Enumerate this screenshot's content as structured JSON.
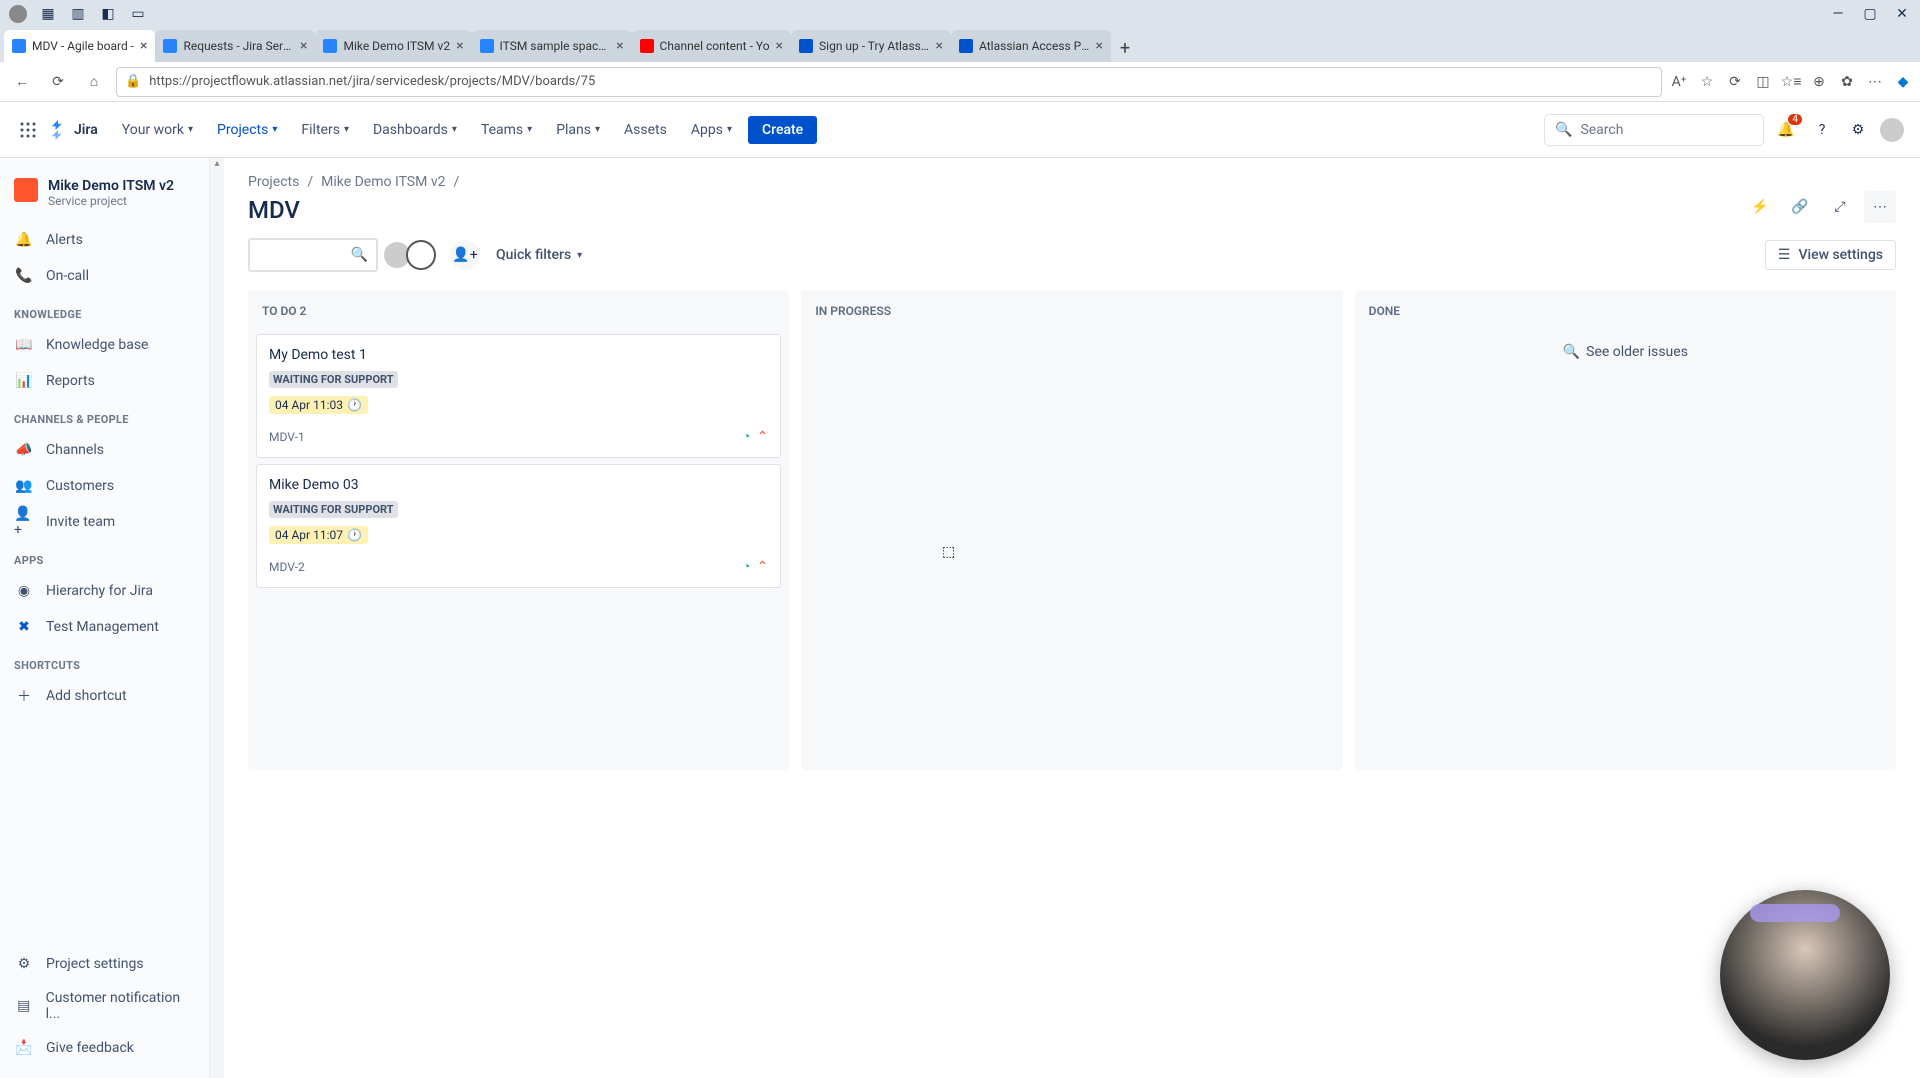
{
  "browser": {
    "url": "https://projectflowuk.atlassian.net/jira/servicedesk/projects/MDV/boards/75",
    "tabs": [
      {
        "title": "MDV - Agile board -",
        "active": true,
        "fav": "jira"
      },
      {
        "title": "Requests - Jira Servic",
        "fav": "jira"
      },
      {
        "title": "Mike Demo ITSM v2",
        "fav": "jira"
      },
      {
        "title": "ITSM sample space -",
        "fav": "jira"
      },
      {
        "title": "Channel content - Yo",
        "fav": "yt"
      },
      {
        "title": "Sign up - Try Atlassian",
        "fav": "atl"
      },
      {
        "title": "Atlassian Access Prici",
        "fav": "atl"
      }
    ]
  },
  "topnav": {
    "product": "Jira",
    "items": [
      "Your work",
      "Projects",
      "Filters",
      "Dashboards",
      "Teams",
      "Plans",
      "Assets",
      "Apps"
    ],
    "active_index": 1,
    "create": "Create",
    "search_placeholder": "Search",
    "notif_count": "4"
  },
  "sidebar": {
    "project_name": "Mike Demo ITSM v2",
    "project_type": "Service project",
    "items_top": [
      {
        "icon": "bell",
        "label": "Alerts"
      },
      {
        "icon": "phone",
        "label": "On-call"
      }
    ],
    "group_knowledge": "KNOWLEDGE",
    "items_knowledge": [
      {
        "icon": "book",
        "label": "Knowledge base"
      },
      {
        "icon": "chart",
        "label": "Reports"
      }
    ],
    "group_channels": "CHANNELS & PEOPLE",
    "items_channels": [
      {
        "icon": "megaphone",
        "label": "Channels"
      },
      {
        "icon": "people",
        "label": "Customers"
      },
      {
        "icon": "invite",
        "label": "Invite team"
      }
    ],
    "group_apps": "APPS",
    "items_apps": [
      {
        "icon": "hierarchy",
        "label": "Hierarchy for Jira"
      },
      {
        "icon": "test",
        "label": "Test Management"
      }
    ],
    "group_shortcuts": "SHORTCUTS",
    "items_shortcuts": [
      {
        "icon": "plus",
        "label": "Add shortcut"
      }
    ],
    "items_bottom": [
      {
        "icon": "gear",
        "label": "Project settings"
      },
      {
        "icon": "list",
        "label": "Customer notification l..."
      },
      {
        "icon": "feedback",
        "label": "Give feedback"
      }
    ]
  },
  "breadcrumb": [
    "Projects",
    "Mike Demo ITSM v2"
  ],
  "page_title": "MDV",
  "toolbar": {
    "quick_filters": "Quick filters",
    "view_settings": "View settings"
  },
  "board": {
    "columns": [
      {
        "title": "TO DO 2"
      },
      {
        "title": "IN PROGRESS"
      },
      {
        "title": "DONE",
        "older": "See older issues"
      }
    ],
    "cards": [
      {
        "title": "My Demo test 1",
        "status": "WAITING FOR SUPPORT",
        "due": "04 Apr 11:03",
        "key": "MDV-1"
      },
      {
        "title": "Mike Demo 03",
        "status": "WAITING FOR SUPPORT",
        "due": "04 Apr 11:07",
        "key": "MDV-2"
      }
    ]
  }
}
